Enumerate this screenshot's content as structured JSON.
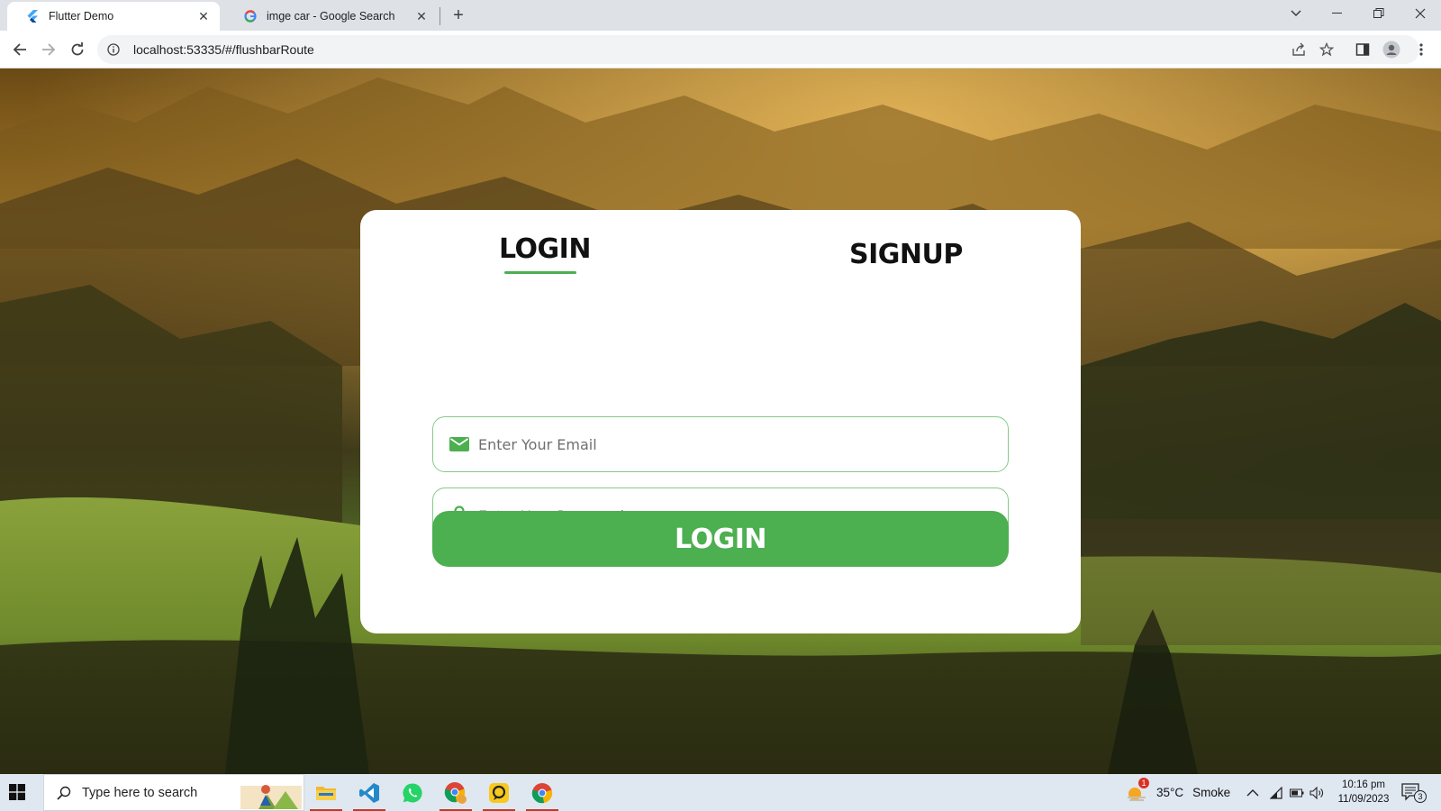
{
  "browser": {
    "tabs": [
      {
        "title": "Flutter Demo",
        "active": true,
        "icon": "flutter-icon"
      },
      {
        "title": "imge car - Google Search",
        "active": false,
        "icon": "google-icon"
      }
    ],
    "url": "localhost:53335/#/flushbarRoute"
  },
  "app": {
    "tabs": {
      "login": "LOGIN",
      "signup": "SIGNUP"
    },
    "email_placeholder": "Enter Your Email",
    "password_placeholder": "Enter Your Password",
    "login_button": "LOGIN",
    "accent": "#4caf50"
  },
  "taskbar": {
    "search_placeholder": "Type here to search",
    "weather": {
      "temp": "35°C",
      "condition": "Smoke",
      "alert_count": "1"
    },
    "time": "10:16 pm",
    "date": "11/09/2023",
    "notification_count": "3"
  }
}
